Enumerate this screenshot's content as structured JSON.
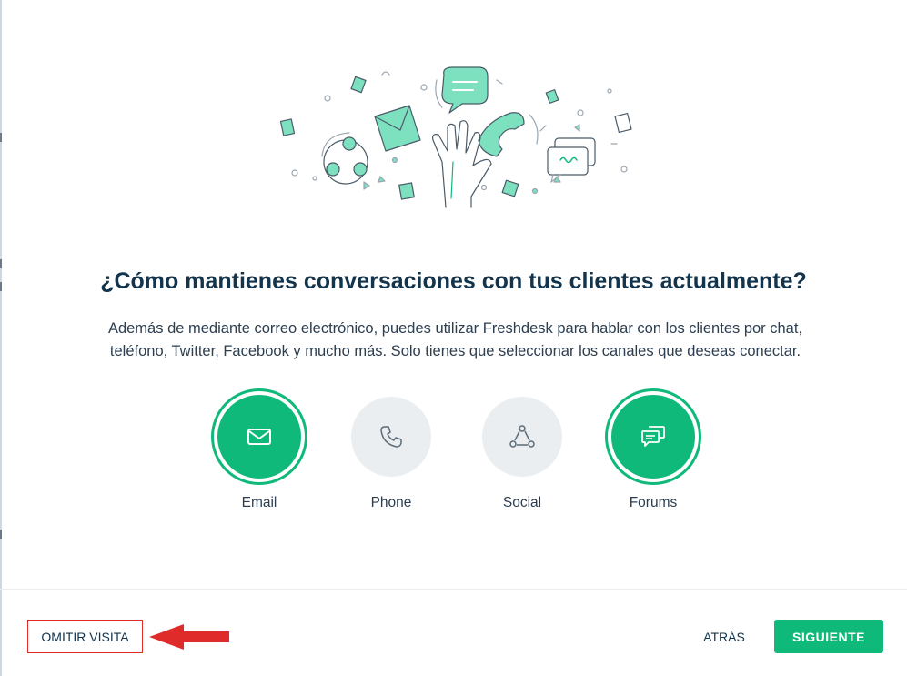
{
  "heading": {
    "title": "¿Cómo mantienes conversaciones con tus clientes actualmente?",
    "description": "Además de mediante correo electrónico, puedes utilizar Freshdesk para hablar con los clientes por chat, teléfono, Twitter, Facebook y mucho más. Solo tienes que seleccionar los canales que deseas conectar."
  },
  "channels": [
    {
      "label": "Email",
      "icon": "envelope-icon",
      "selected": true
    },
    {
      "label": "Phone",
      "icon": "phone-icon",
      "selected": false
    },
    {
      "label": "Social",
      "icon": "social-network-icon",
      "selected": false
    },
    {
      "label": "Forums",
      "icon": "forums-icon",
      "selected": true
    }
  ],
  "footer": {
    "skip_label": "OMITIR VISITA",
    "back_label": "ATRÁS",
    "next_label": "SIGUIENTE"
  },
  "colors": {
    "accent": "#0fb97a",
    "annotation": "#e02b2b",
    "unselected_bg": "#ebeef0",
    "text": "#12344d"
  }
}
